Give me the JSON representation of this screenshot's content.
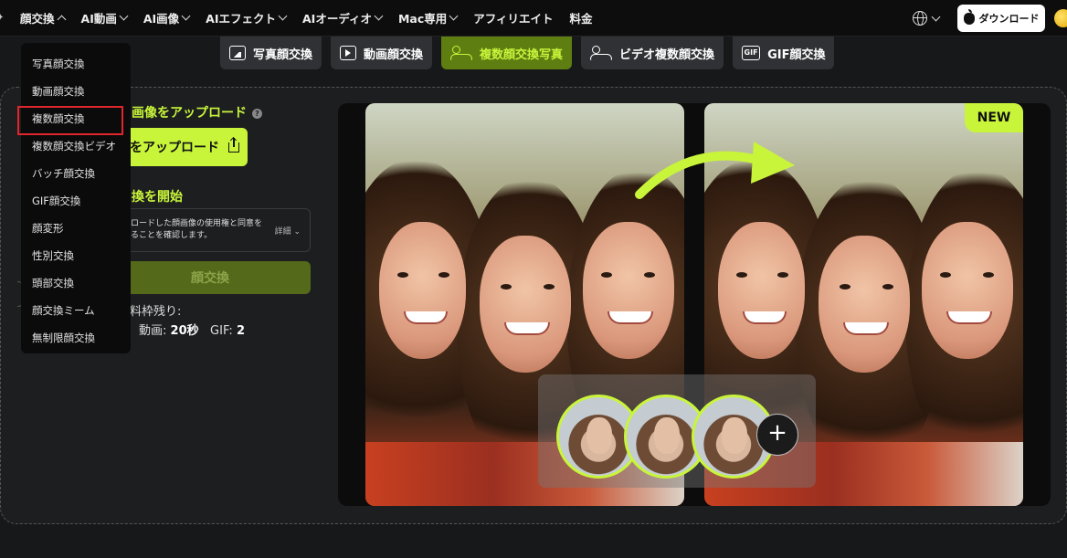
{
  "nav": {
    "items": [
      {
        "label": "顔交換",
        "open": true
      },
      {
        "label": "AI動画",
        "open": false
      },
      {
        "label": "AI画像",
        "open": false
      },
      {
        "label": "AIエフェクト",
        "open": false
      },
      {
        "label": "AIオーディオ",
        "open": false
      },
      {
        "label": "Mac専用",
        "open": false
      },
      {
        "label": "アフィリエイト"
      },
      {
        "label": "料金"
      }
    ],
    "download_label": "ダウンロード"
  },
  "dropdown": {
    "items": [
      "写真顔交換",
      "動画顔交換",
      "複数顔交換",
      "複数顔交換ビデオ",
      "バッチ顔交換",
      "GIF顔交換",
      "顔変形",
      "性別交換",
      "頭部交換",
      "顔交換ミーム",
      "無制限顔交換"
    ],
    "highlighted": "複数顔交換"
  },
  "tabs": [
    {
      "label": "写真顔交換",
      "icon": "image-icon"
    },
    {
      "label": "動画顔交換",
      "icon": "play-icon"
    },
    {
      "label": "複数顔交換写真",
      "icon": "people-icon",
      "active": true
    },
    {
      "label": "ビデオ複数顔交換",
      "icon": "people-icon"
    },
    {
      "label": "GIF顔交換",
      "icon": "gif-icon"
    }
  ],
  "left": {
    "step1_title": "画像をアップロード",
    "upload_label": "をアップロード",
    "step2_title": "換を開始",
    "consent_text": "ロードした顔画像の使用権と同意を\nることを確認します。",
    "consent_more": "詳細",
    "swap_label": "顔交換",
    "quota_label": "料枠残り:",
    "quota_video_label": "動画:",
    "quota_video_value": "20秒",
    "quota_gif_label": "GIF:",
    "quota_gif_value": "2"
  },
  "preview": {
    "badge": "NEW",
    "add_label": "+"
  },
  "colors": {
    "accent": "#c8f53a",
    "highlight_box": "#e0262c"
  }
}
